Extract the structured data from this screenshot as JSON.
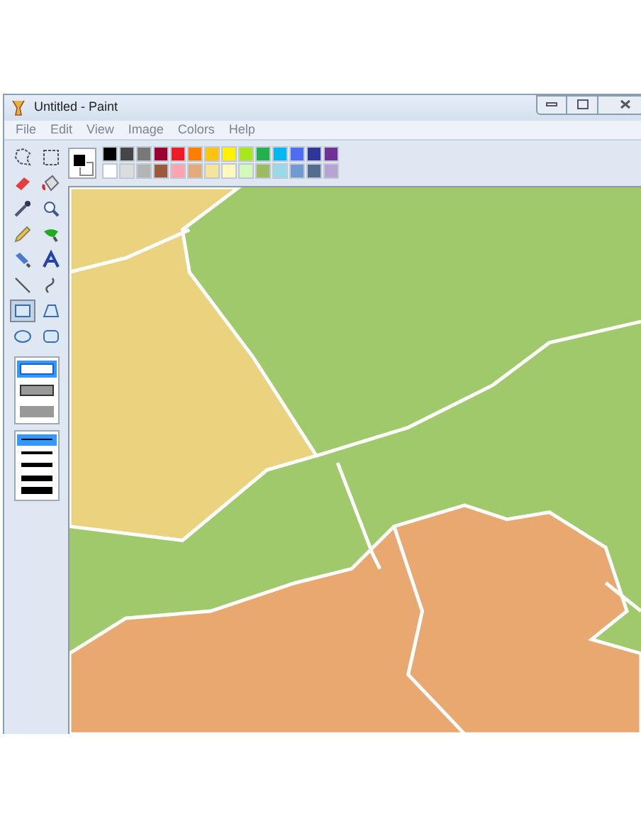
{
  "window": {
    "title": "Untitled - Paint"
  },
  "menu": [
    {
      "label": "File"
    },
    {
      "label": "Edit"
    },
    {
      "label": "View"
    },
    {
      "label": "Image"
    },
    {
      "label": "Colors"
    },
    {
      "label": "Help"
    }
  ],
  "tools": [
    {
      "kind": "free-select",
      "selected": false
    },
    {
      "kind": "select",
      "selected": false
    },
    {
      "kind": "eraser",
      "selected": false
    },
    {
      "kind": "fill",
      "selected": false
    },
    {
      "kind": "picker",
      "selected": false
    },
    {
      "kind": "magnifier",
      "selected": false
    },
    {
      "kind": "pencil",
      "selected": false
    },
    {
      "kind": "brush",
      "selected": false
    },
    {
      "kind": "airbrush",
      "selected": false
    },
    {
      "kind": "text",
      "selected": false
    },
    {
      "kind": "line",
      "selected": false
    },
    {
      "kind": "curve",
      "selected": false
    },
    {
      "kind": "rectangle",
      "selected": true
    },
    {
      "kind": "polygon",
      "selected": false
    },
    {
      "kind": "ellipse",
      "selected": false
    },
    {
      "kind": "rounded-rectangle",
      "selected": false
    }
  ],
  "fill_styles": [
    {
      "kind": "outline",
      "selected": true
    },
    {
      "kind": "outline-fill",
      "selected": false
    },
    {
      "kind": "fill",
      "selected": false
    }
  ],
  "line_widths": [
    {
      "selected": true
    },
    {
      "selected": false
    },
    {
      "selected": false
    },
    {
      "selected": false
    },
    {
      "selected": false
    }
  ],
  "current_colors": [
    {
      "kind": "foreground",
      "color": "#000000"
    },
    {
      "kind": "background",
      "color": "#ffffff"
    }
  ],
  "palette": [
    {
      "color": "#000000"
    },
    {
      "color": "#464646"
    },
    {
      "color": "#787878"
    },
    {
      "color": "#990030"
    },
    {
      "color": "#ed1c24"
    },
    {
      "color": "#ff7e00"
    },
    {
      "color": "#ffc20e"
    },
    {
      "color": "#fff200"
    },
    {
      "color": "#a8e61d"
    },
    {
      "color": "#22b14c"
    },
    {
      "color": "#00b7ef"
    },
    {
      "color": "#4d6df3"
    },
    {
      "color": "#2f3699"
    },
    {
      "color": "#6f3198"
    },
    {
      "color": "#ffffff"
    },
    {
      "color": "#dcdcdc"
    },
    {
      "color": "#b4b4b4"
    },
    {
      "color": "#9c5a3c"
    },
    {
      "color": "#ffa3b1"
    },
    {
      "color": "#e5aa7a"
    },
    {
      "color": "#f5e49c"
    },
    {
      "color": "#fff9bd"
    },
    {
      "color": "#d3f9bc"
    },
    {
      "color": "#9dbb61"
    },
    {
      "color": "#99d9ea"
    },
    {
      "color": "#709ad1"
    },
    {
      "color": "#546d8e"
    },
    {
      "color": "#b5a5d5"
    }
  ]
}
